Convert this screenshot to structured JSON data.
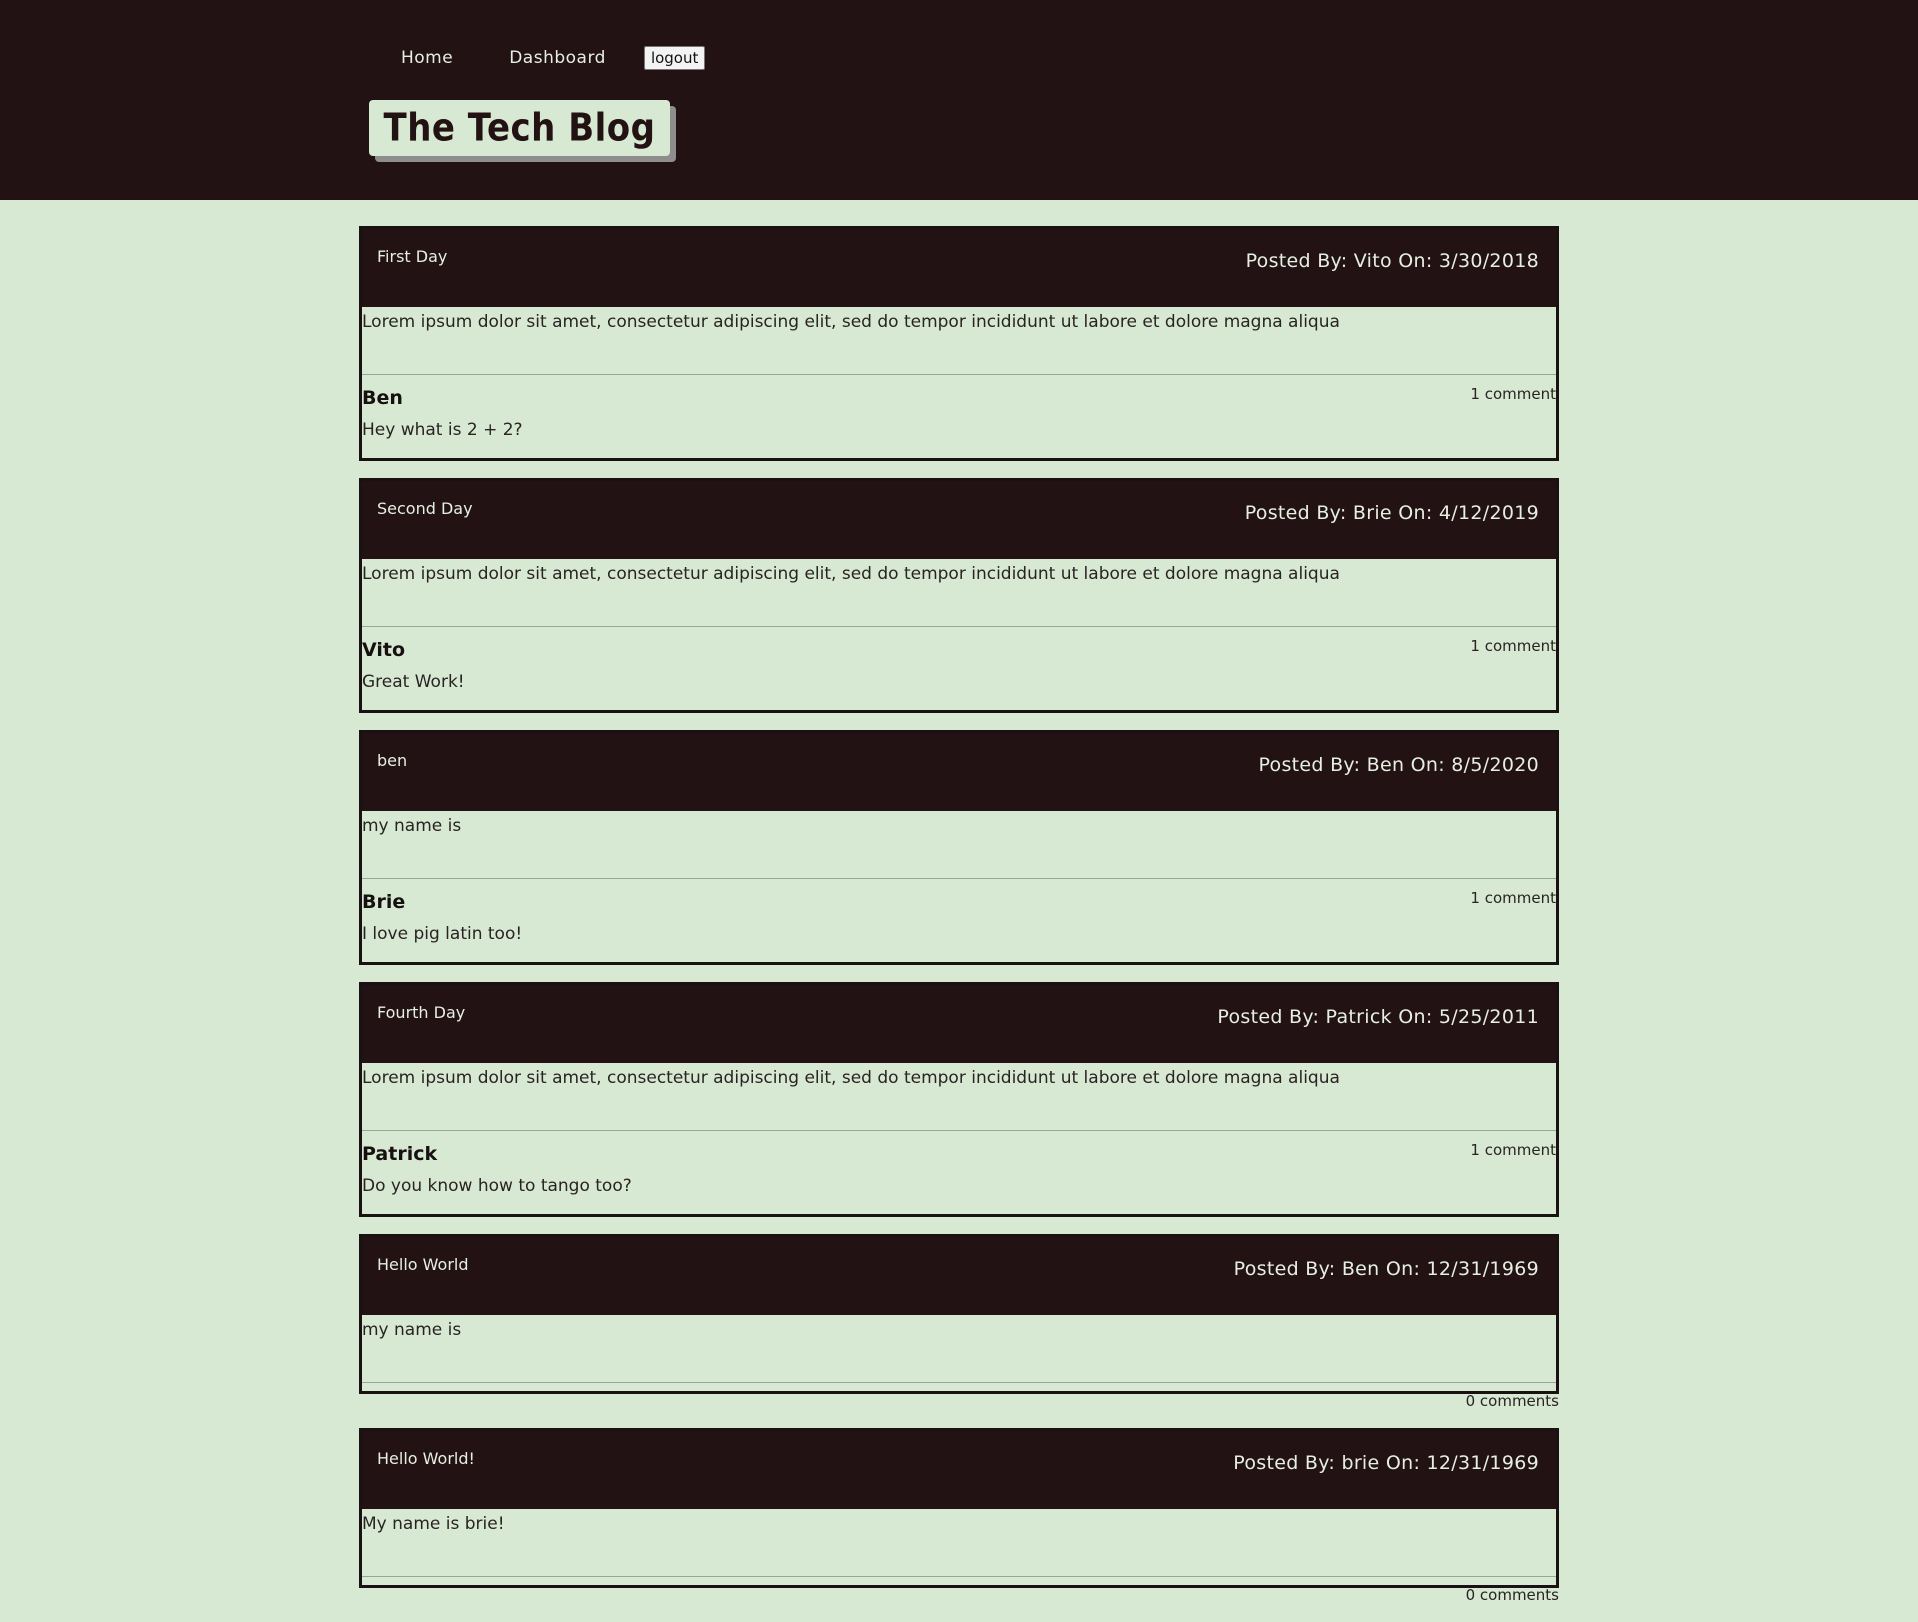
{
  "header": {
    "nav": {
      "home": "Home",
      "dashboard": "Dashboard",
      "logout": "logout"
    },
    "logo": "The Tech Blog"
  },
  "posts": [
    {
      "title": "First Day",
      "meta": "Posted By: Vito On: 3/30/2018",
      "body": "Lorem ipsum dolor sit amet, consectetur adipiscing elit, sed do tempor incididunt ut labore et dolore magna aliqua",
      "comment_count": "1 comment",
      "comment_author": "Ben",
      "comment_text": "Hey what is 2 + 2?"
    },
    {
      "title": "Second Day",
      "meta": "Posted By: Brie On: 4/12/2019",
      "body": "Lorem ipsum dolor sit amet, consectetur adipiscing elit, sed do tempor incididunt ut labore et dolore magna aliqua",
      "comment_count": "1 comment",
      "comment_author": "Vito",
      "comment_text": "Great Work!"
    },
    {
      "title": "ben",
      "meta": "Posted By: Ben On: 8/5/2020",
      "body": "my name is",
      "comment_count": "1 comment",
      "comment_author": "Brie",
      "comment_text": "I love pig latin too!"
    },
    {
      "title": "Fourth Day",
      "meta": "Posted By: Patrick On: 5/25/2011",
      "body": "Lorem ipsum dolor sit amet, consectetur adipiscing elit, sed do tempor incididunt ut labore et dolore magna aliqua",
      "comment_count": "1 comment",
      "comment_author": "Patrick",
      "comment_text": "Do you know how to tango too?"
    },
    {
      "title": "Hello World",
      "meta": "Posted By: Ben On: 12/31/1969",
      "body": "my name is",
      "comment_count": "0 comments"
    },
    {
      "title": "Hello World!",
      "meta": "Posted By: brie On: 12/31/1969",
      "body": "My name is brie!",
      "comment_count": "0 comments"
    }
  ]
}
